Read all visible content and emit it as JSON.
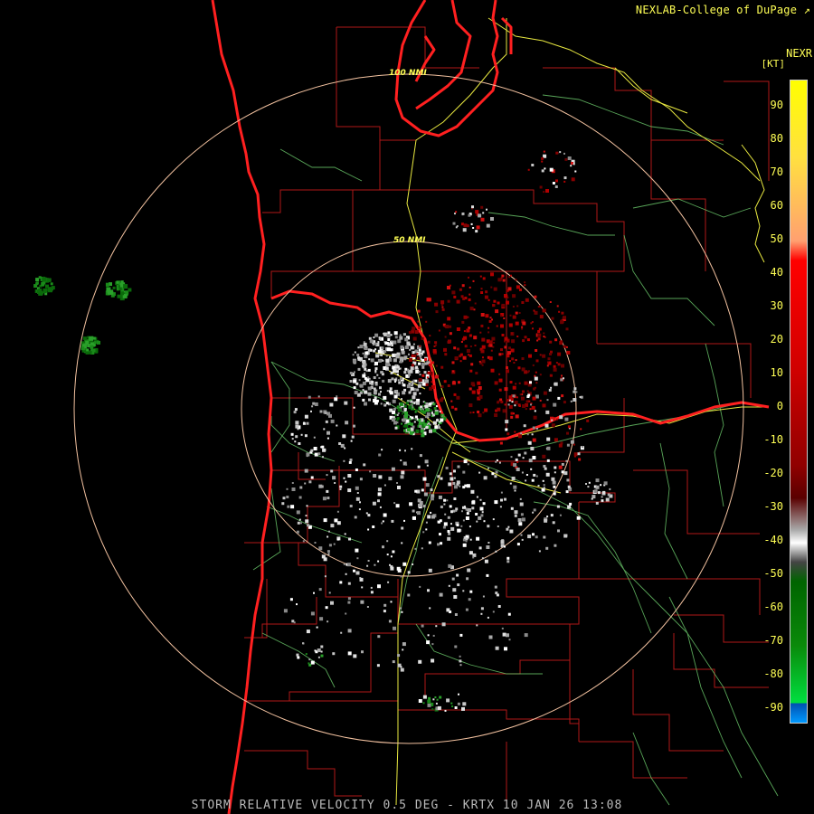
{
  "header": {
    "credit": "NEXLAB-College of DuPage",
    "credit_icon": "external-link-icon",
    "nexr": "NEXR",
    "unit": "[KT]"
  },
  "footer": {
    "product_line": "STORM RELATIVE VELOCITY 0.5 DEG - KRTX 10 JAN 26 13:08"
  },
  "map": {
    "range_rings": [
      {
        "label": "100 NMI"
      },
      {
        "label": "50 NMI"
      }
    ],
    "colors": {
      "background": "#000000",
      "coastline": "#ff2020",
      "county_lines": "#b01818",
      "rivers": "#6fcf6f",
      "highways": "#e8e840",
      "rings": "#f3c2a0"
    }
  },
  "legend": {
    "ticks": [
      "90",
      "80",
      "70",
      "60",
      "50",
      "40",
      "30",
      "20",
      "10",
      "0",
      "-10",
      "-20",
      "-30",
      "-40",
      "-50",
      "-60",
      "-70",
      "-80",
      "-90"
    ],
    "colors": {
      "outbound_high": "#ffff00",
      "outbound_mid": "#ff0000",
      "outbound_low": "#5a0000",
      "near_zero": "#aaaaaa",
      "inbound_low": "#006400",
      "inbound_mid": "#00e040",
      "inbound_high": "#0099ff"
    }
  }
}
